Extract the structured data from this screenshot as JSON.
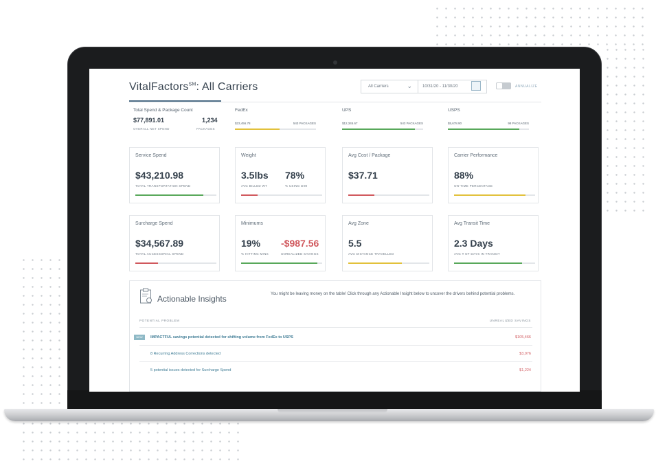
{
  "header": {
    "brand": "VitalFactors",
    "brand_mark": "SM",
    "title_suffix": ": All Carriers",
    "carrier_select": "All Carriers",
    "date_range": "10/31/20 - 11/30/20",
    "toggle_label": "ANNUALIZE"
  },
  "summary": {
    "total": {
      "label": "Total Spend & Package Count",
      "spend": "$77,891.01",
      "spend_caption": "OVERALL NET SPEND",
      "count": "1,234",
      "count_caption": "PACKAGES"
    },
    "carriers": [
      {
        "name": "FedEx",
        "spend": "$23,456.78",
        "packages": "543 PACKAGES",
        "color": "#e2c13b",
        "fill": 0.55
      },
      {
        "name": "UPS",
        "spend": "$12,345.67",
        "packages": "543 PACKAGES",
        "color": "#58a85a",
        "fill": 0.9
      },
      {
        "name": "USPS",
        "spend": "$5,678.90",
        "packages": "98 PACKAGES",
        "color": "#58a85a",
        "fill": 0.88
      }
    ]
  },
  "cards": [
    {
      "label": "Service Spend",
      "value": "$43,210.98",
      "sub": "TOTAL TRANSPORTATION SPEND",
      "color": "#58a85a",
      "fill": 0.84
    },
    {
      "label": "Weight",
      "value": "3.5lbs",
      "value2": "78%",
      "sub": "AVG BILLED WT",
      "sub2": "% USING DIM",
      "color": "#d0585d",
      "fill": 0.2
    },
    {
      "label": "Avg Cost / Package",
      "value": "$37.71",
      "color": "#d0585d",
      "fill": 0.32
    },
    {
      "label": "Carrier Performance",
      "value": "88%",
      "sub": "ON-TIME PERCENTAGE",
      "color": "#e2c13b",
      "fill": 0.88
    },
    {
      "label": "Surcharge Spend",
      "value": "$34,567.89",
      "sub": "TOTAL ACCESSORIAL SPEND",
      "color": "#d0585d",
      "fill": 0.28
    },
    {
      "label": "Minimums",
      "value": "19%",
      "value2": "-$987.56",
      "sub": "% HITTING MINS",
      "sub2": "UNREALIZED SAVINGS",
      "value2_color": "#d0585d",
      "color": "#58a85a",
      "fill": 0.94
    },
    {
      "label": "Avg Zone",
      "value": "5.5",
      "sub": "AVG DISTANCE TRAVELLED",
      "color": "#e2c13b",
      "fill": 0.66
    },
    {
      "label": "Avg Transit Time",
      "value": "2.3 Days",
      "sub": "AVG # OF DAYS IN TRANSIT",
      "color": "#58a85a",
      "fill": 0.84
    }
  ],
  "insights": {
    "title": "Actionable Insights",
    "text": "You might be leaving money on the table! Click through any Actionable Insight below to uncover the drivers behind potential problems.",
    "col_problem": "POTENTIAL PROBLEM",
    "col_savings": "UNREALIZED SAVINGS",
    "new_badge": "NEW",
    "rows": [
      {
        "problem": "IMPACTFUL savings potential detected for shifting volume from FedEx to USPS",
        "savings": "$105,466"
      },
      {
        "problem": "8 Recurring Address Corrections detected",
        "savings": "$3,076"
      },
      {
        "problem": "5 potential issues detected for Surcharge Spend",
        "savings": "$1,224"
      }
    ]
  }
}
